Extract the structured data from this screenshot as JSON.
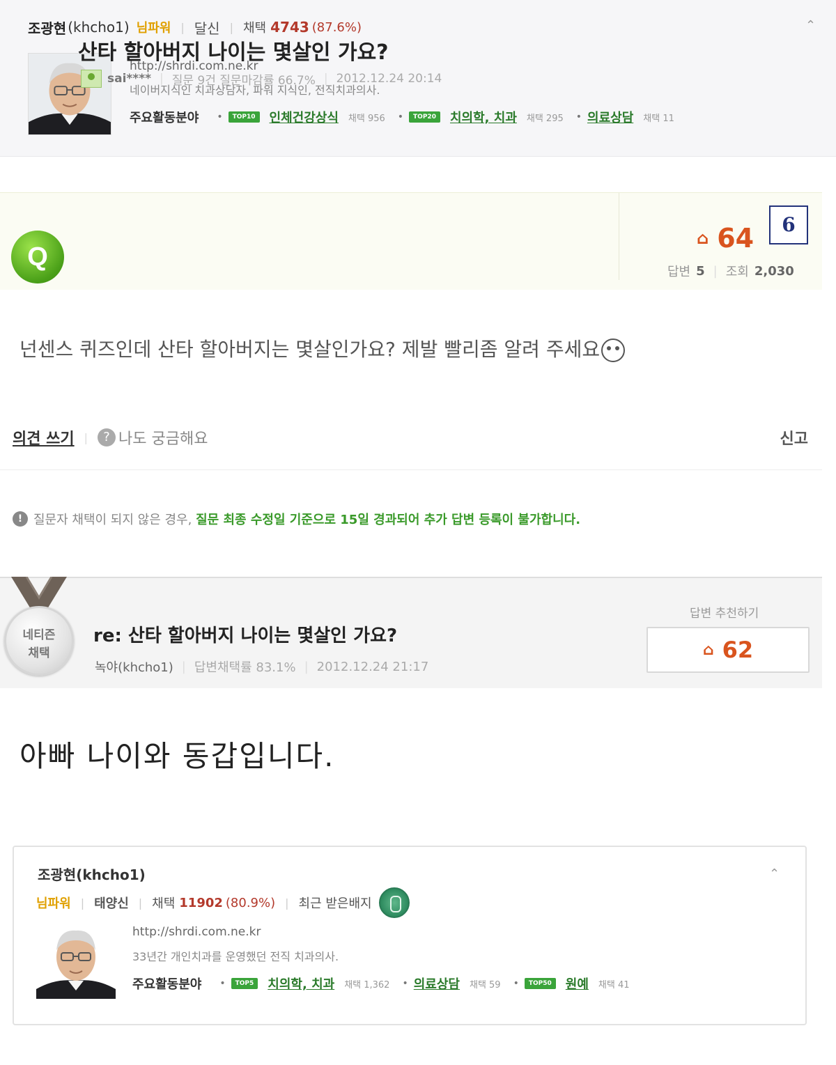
{
  "top_profile": {
    "name": "조광현",
    "user_id": "(khcho1)",
    "grade": "님파워",
    "title": "달신",
    "adopt_label": "채택",
    "adopt_count": "4743",
    "adopt_pct": "(87.6%)",
    "url": "http://shrdi.com.ne.kr",
    "description": "네이버지식인 치과상담자, 파워 지식인, 전직치과의사.",
    "fields_label": "주요활동분야",
    "fields": [
      {
        "badge": "TOP10",
        "name": "인체건강상식",
        "count": "채택 956"
      },
      {
        "badge": "TOP20",
        "name": "치의학, 치과",
        "count": "채택 295"
      },
      {
        "badge": "",
        "name": "의료상담",
        "count": "채택 11"
      }
    ]
  },
  "question": {
    "icon_letter": "Q",
    "title": "산타 할아버지 나이는 몇살인 가요?",
    "user": "sai****",
    "stats": "질문 9건 질문마감률 66.7%",
    "date": "2012.12.24 20:14",
    "number_box": "6",
    "likes": "64",
    "answers_label": "답변",
    "answers": "5",
    "views_label": "조회",
    "views": "2,030",
    "body": "넌센스 퀴즈인데 산타 할아버지는 몇살인가요? 제발 빨리좀 알려 주세요"
  },
  "actions": {
    "write": "의견 쓰기",
    "curious": "나도 궁금해요",
    "report": "신고"
  },
  "notice": {
    "text_gray": "질문자 채택이 되지 않은 경우,",
    "text_green": "질문 최종 수정일 기준으로 15일 경과되어 추가 답변 등록이 불가합니다."
  },
  "answer": {
    "medal_line1": "네티즌",
    "medal_line2": "채택",
    "title": "re: 산타 할아버지 나이는 몇살인 가요?",
    "user": "녹야(khcho1)",
    "stats": "답변채택률 83.1%",
    "date": "2012.12.24 21:17",
    "recommend_label": "답변 추천하기",
    "likes": "62",
    "body": "아빠 나이와 동갑입니다."
  },
  "bottom_profile": {
    "name": "조광현(khcho1)",
    "grade": "님파워",
    "title": "태양신",
    "adopt_label": "채택",
    "adopt_count": "11902",
    "adopt_pct": "(80.9%)",
    "badge_label": "최근 받은배지",
    "url": "http://shrdi.com.ne.kr",
    "description": "33년간 개인치과를 운영했던 전직 치과의사.",
    "fields_label": "주요활동분야",
    "fields": [
      {
        "badge": "TOP5",
        "name": "치의학, 치과",
        "count": "채택 1,362"
      },
      {
        "badge": "",
        "name": "의료상담",
        "count": "채택 59"
      },
      {
        "badge": "TOP50",
        "name": "원예",
        "count": "채택 41"
      }
    ]
  },
  "colors": {
    "accent_green": "#3a9a2a",
    "like_orange": "#d9541e",
    "adopt_red": "#b3392b",
    "grade_yellow": "#e0a000"
  }
}
